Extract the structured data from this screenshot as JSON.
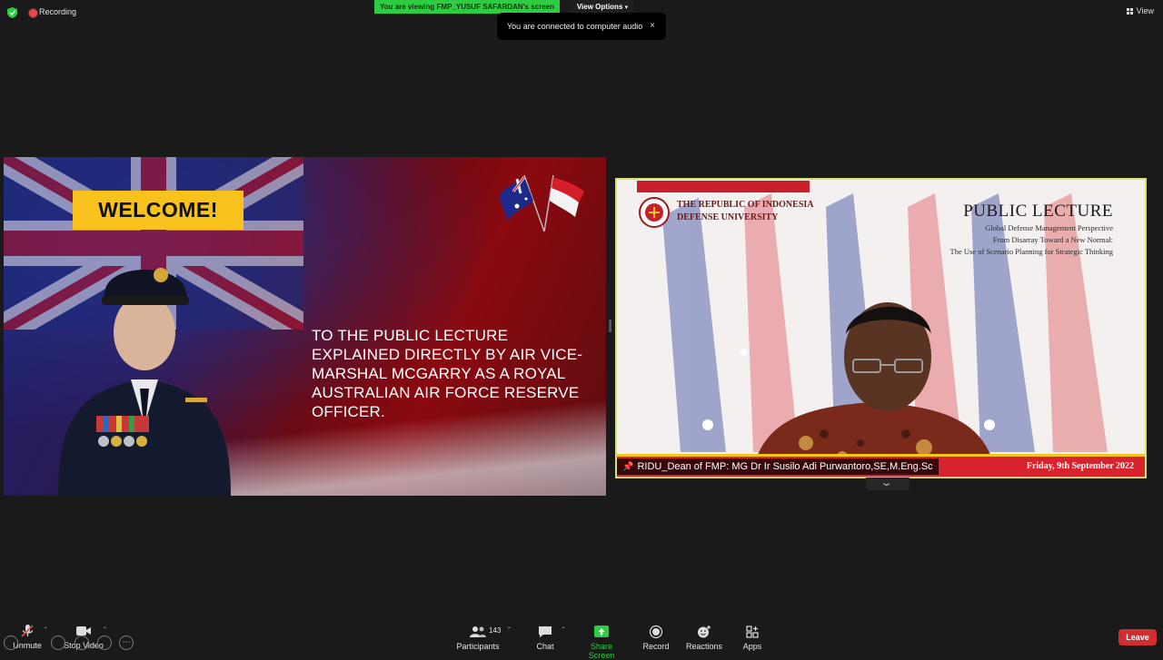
{
  "topbar": {
    "recording_label": "Recording",
    "viewing_banner": "You are viewing FMP_YUSUF SAFARDAN's screen",
    "view_options_label": "View Options",
    "audio_toast": "You are connected to computer audio",
    "close_glyph": "×",
    "view_label": "View"
  },
  "slide": {
    "welcome": "WELCOME!",
    "body": "TO THE PUBLIC LECTURE EXPLAINED DIRECTLY BY AIR VICE-MARSHAL MCGARRY AS A ROYAL AUSTRALIAN AIR FORCE RESERVE OFFICER."
  },
  "speaker": {
    "uni_line1": "THE REPUBLIC OF INDONESIA",
    "uni_line2": "DEFENSE UNIVERSITY",
    "lecture_title": "PUBLIC LECTURE",
    "subtitle_lines": [
      "Global Defense Management Perspective",
      "From Disarray Toward a New Normal:",
      "The Use of Scenario Planning for Strategic Thinking"
    ],
    "date": "Friday, 9th September 2022",
    "name_tag": "RIDU_Dean of FMP: MG Dr Ir Susilo Adi Purwantoro,SE,M.Eng.Sc"
  },
  "toolbar": {
    "unmute": "Unmute",
    "stop_video": "Stop Video",
    "participants": "Participants",
    "participants_count": "143",
    "chat": "Chat",
    "share_screen": "Share Screen",
    "record": "Record",
    "reactions": "Reactions",
    "apps": "Apps",
    "leave": "Leave"
  },
  "colors": {
    "share_green": "#2ecc40",
    "leave_red": "#d12f2f",
    "welcome_yellow": "#f7c21b",
    "active_border": "#d6e26a"
  }
}
